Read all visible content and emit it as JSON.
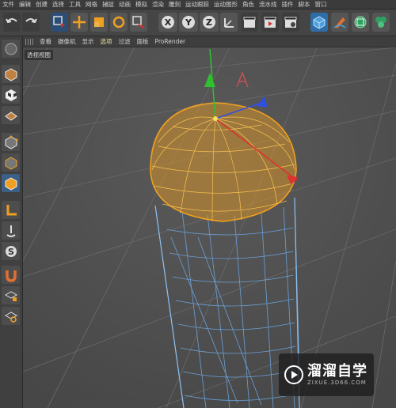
{
  "menu": [
    "文件",
    "编辑",
    "创建",
    "选择",
    "工具",
    "网格",
    "捕捉",
    "动画",
    "模拟",
    "渲染",
    "雕刻",
    "运动跟踪",
    "运动图形",
    "角色",
    "流水线",
    "插件",
    "脚本",
    "窗口"
  ],
  "viewport_menu": [
    "查看",
    "摄像机",
    "显示",
    "选项",
    "过滤",
    "面板",
    "ProRender"
  ],
  "viewport_label": "透视视图",
  "axis_buttons": {
    "x": "X",
    "y": "Y",
    "z": "Z"
  },
  "watermark": {
    "title": "溜溜自学",
    "url": "ZIXUE.3D66.COM"
  },
  "colors": {
    "selection_orange": "#f0a020",
    "wire_blue": "#6aa0d8",
    "axis_x": "#e03030",
    "axis_y": "#30c030",
    "axis_z": "#3050e0"
  }
}
